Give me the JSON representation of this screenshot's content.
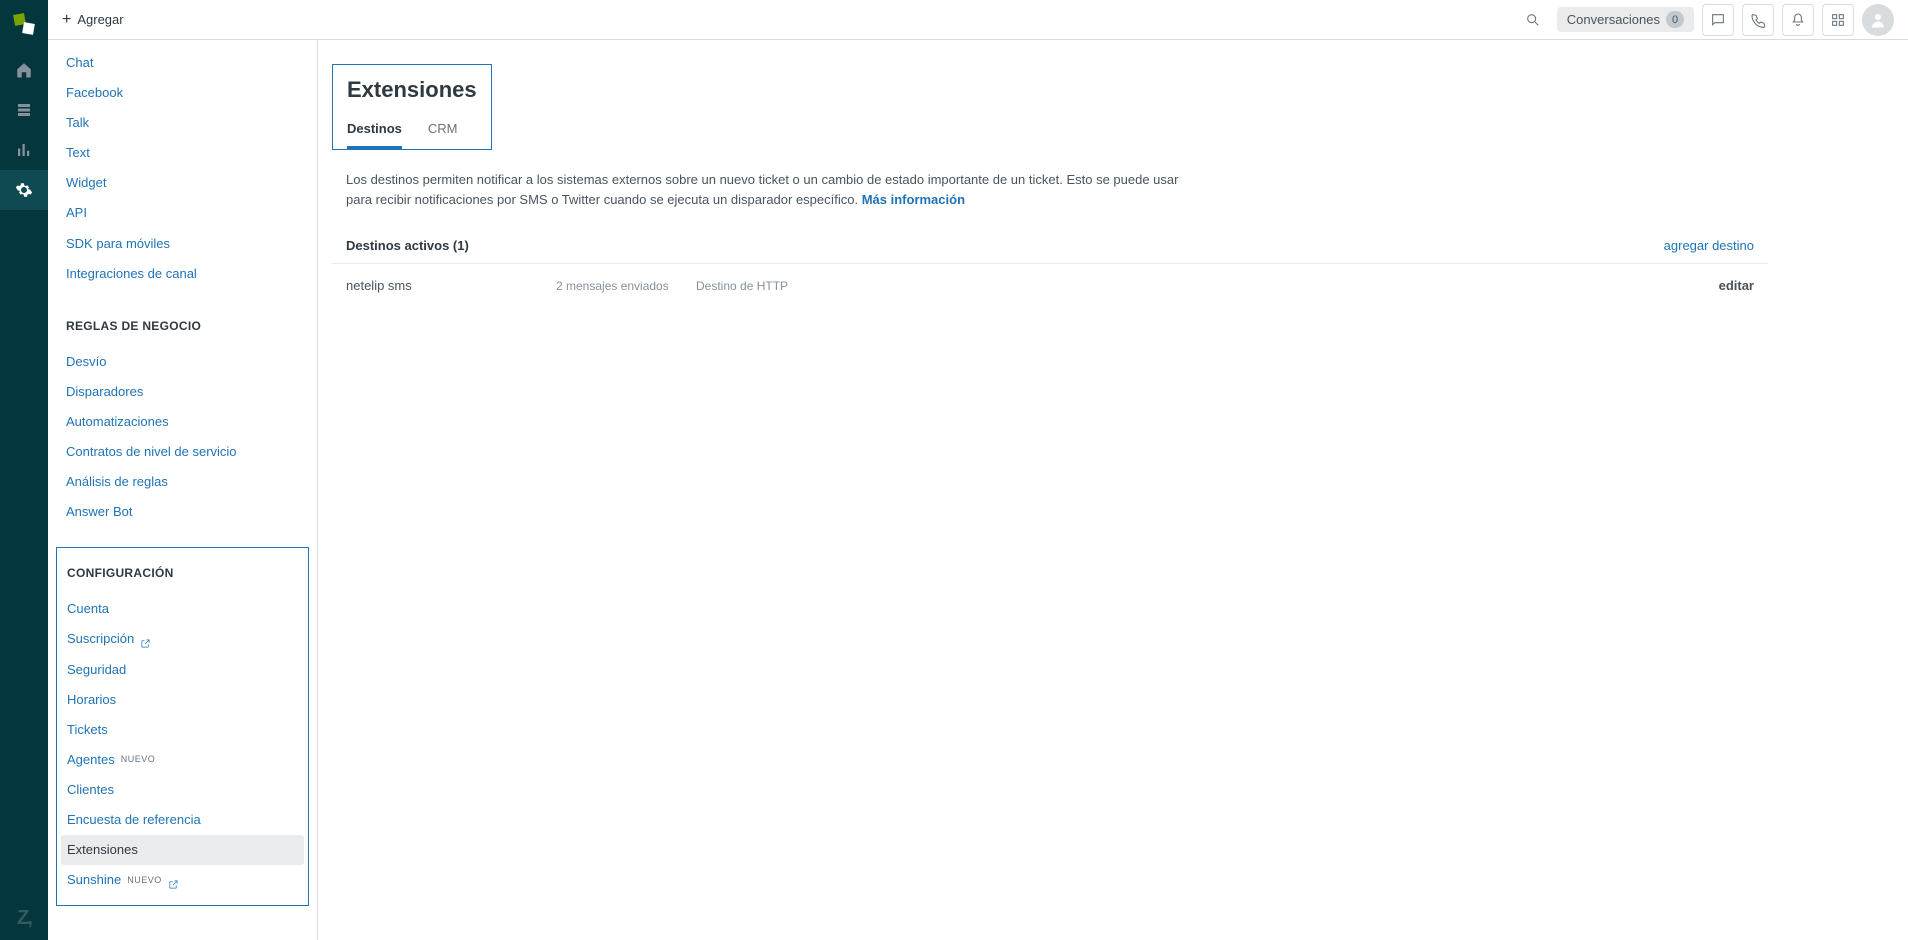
{
  "topbar": {
    "add_label": "Agregar",
    "conversations_label": "Conversaciones",
    "conversations_count": "0"
  },
  "sidebar": {
    "channels": {
      "items": [
        "Chat",
        "Facebook",
        "Talk",
        "Text",
        "Widget",
        "API",
        "SDK para móviles",
        "Integraciones de canal"
      ]
    },
    "business_rules": {
      "title": "REGLAS DE NEGOCIO",
      "items": [
        "Desvío",
        "Disparadores",
        "Automatizaciones",
        "Contratos de nivel de servicio",
        "Análisis de reglas",
        "Answer Bot"
      ]
    },
    "configuration": {
      "title": "CONFIGURACIÓN",
      "items": [
        {
          "label": "Cuenta"
        },
        {
          "label": "Suscripción",
          "external": true
        },
        {
          "label": "Seguridad"
        },
        {
          "label": "Horarios"
        },
        {
          "label": "Tickets"
        },
        {
          "label": "Agentes",
          "badge": "NUEVO"
        },
        {
          "label": "Clientes"
        },
        {
          "label": "Encuesta de referencia"
        },
        {
          "label": "Extensiones",
          "active": true
        },
        {
          "label": "Sunshine",
          "badge": "NUEVO",
          "external": true
        }
      ]
    }
  },
  "page": {
    "title": "Extensiones",
    "tabs": [
      {
        "label": "Destinos",
        "active": true
      },
      {
        "label": "CRM"
      }
    ],
    "description": "Los destinos permiten notificar a los sistemas externos sobre un nuevo ticket o un cambio de estado importante de un ticket. Esto se puede usar para recibir notificaciones por SMS o Twitter cuando se ejecuta un disparador específico.",
    "more_info": "Más información",
    "list_title": "Destinos activos (1)",
    "add_link": "agregar destino",
    "rows": [
      {
        "name": "netelip sms",
        "messages": "2 mensajes enviados",
        "type": "Destino de HTTP",
        "edit": "editar"
      }
    ]
  }
}
